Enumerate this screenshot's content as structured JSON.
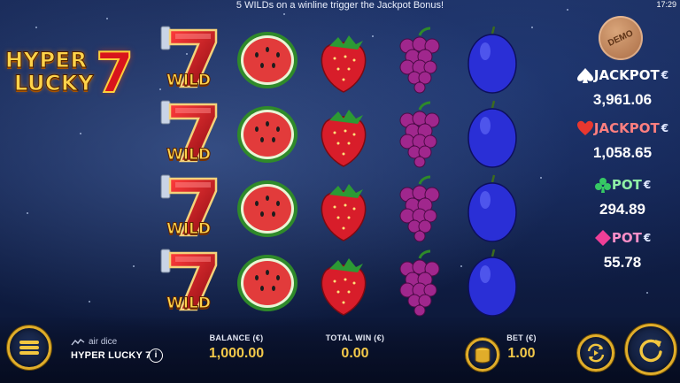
{
  "top_message": "5 WILDs on a winline trigger the Jackpot Bonus!",
  "clock": "17:29",
  "logo": {
    "line1": "HYPER",
    "line2": "LUCKY",
    "numeral": "7"
  },
  "demo_badge": "DEMO",
  "reels": [
    {
      "symbol": "seven-wild",
      "label": "WILD"
    },
    {
      "symbol": "watermelon"
    },
    {
      "symbol": "strawberry"
    },
    {
      "symbol": "grapes"
    },
    {
      "symbol": "plum"
    }
  ],
  "rows": 4,
  "jackpots": [
    {
      "suit": "spade-icon",
      "name": "JACKPOT",
      "currency": "€",
      "value": "3,961.06",
      "color": "#ffffff",
      "suit_color": "#ffffff"
    },
    {
      "suit": "heart-icon",
      "name": "JACKPOT",
      "currency": "€",
      "value": "1,058.65",
      "color": "#ff7f7f",
      "suit_color": "#e8372f"
    },
    {
      "suit": "club-icon",
      "name": "POT",
      "currency": "€",
      "value": "294.89",
      "color": "#8ff0a6",
      "suit_color": "#36c964"
    },
    {
      "suit": "diamond-icon",
      "name": "POT",
      "currency": "€",
      "value": "55.78",
      "color": "#ff8fc8",
      "suit_color": "#ef3f97"
    }
  ],
  "footer": {
    "brand": "air dice",
    "game_name": "HYPER LUCKY 7",
    "info_label": "i",
    "balance_label": "BALANCE (€)",
    "balance_value": "1,000.00",
    "total_win_label": "TOTAL WIN (€)",
    "total_win_value": "0.00",
    "bet_label": "BET (€)",
    "bet_value": "1.00"
  },
  "colors": {
    "gold": "#e0ad2a",
    "value_gold": "#f3c94a",
    "background": "#132350"
  }
}
